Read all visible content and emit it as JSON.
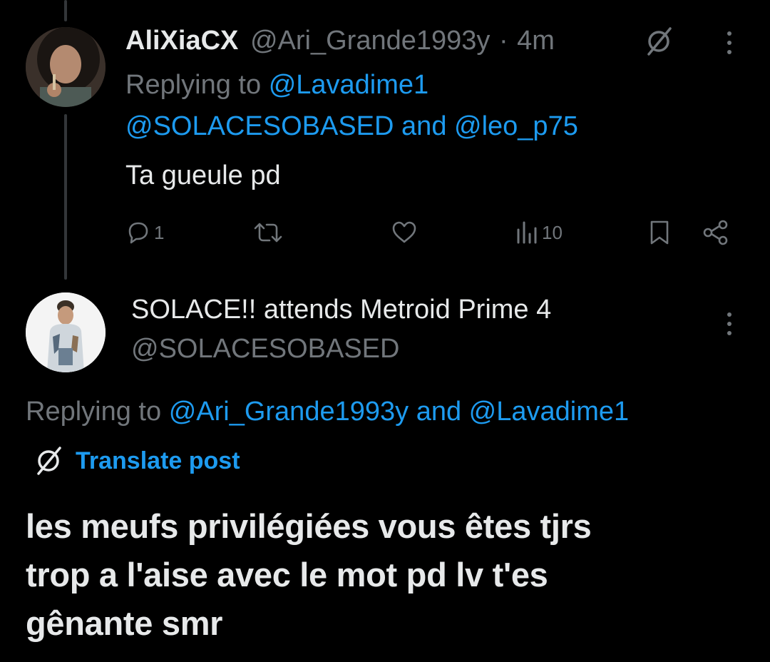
{
  "tweet1": {
    "display_name": "AliXiaCX",
    "handle": "@Ari_Grande1993y",
    "separator": "·",
    "time": "4m",
    "replying_prefix": "Replying to",
    "reply_to_1": "@Lavadime1",
    "reply_to_2": "@SOLACESOBASED",
    "and_word": "and",
    "reply_to_3": "@leo_p75",
    "text": "Ta gueule pd",
    "actions": {
      "replies": "1",
      "reposts": "",
      "likes": "",
      "views": "10"
    }
  },
  "tweet2": {
    "display_name": "SOLACE!! attends Metroid Prime 4",
    "handle": "@SOLACESOBASED",
    "replying_prefix": "Replying to",
    "reply_to_1": "@Ari_Grande1993y",
    "and_word": "and",
    "reply_to_2": "@Lavadime1",
    "translate_label": "Translate post",
    "text": "les meufs privilégiées vous êtes tjrs\ntrop a l'aise avec le mot pd lv t'es\ngênante smr"
  },
  "icons": {
    "grok": "grok-icon",
    "more": "more-options-icon",
    "reply": "reply-icon",
    "repost": "repost-icon",
    "like": "like-icon",
    "views": "views-icon",
    "bookmark": "bookmark-icon",
    "share": "share-icon"
  },
  "colors": {
    "background": "#000000",
    "text": "#e7e9ea",
    "muted": "#71767b",
    "link": "#1d9bf0",
    "thread_line": "#333639"
  }
}
